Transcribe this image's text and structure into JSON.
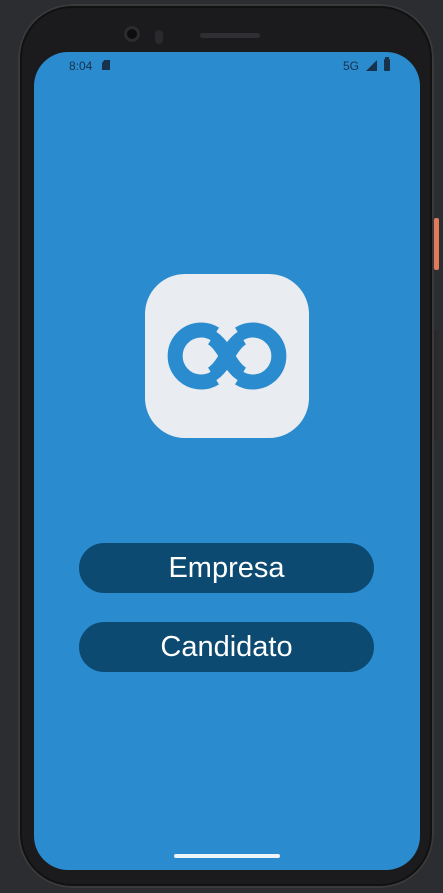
{
  "status_bar": {
    "time": "8:04",
    "network": "5G",
    "icons": [
      "sim-card-icon",
      "signal-icon",
      "battery-icon"
    ]
  },
  "app": {
    "logo_icon": "linked-rings-logo-icon",
    "background_color": "#2a8bcf",
    "button_color": "#0d4a71"
  },
  "buttons": {
    "empresa_label": "Empresa",
    "candidato_label": "Candidato"
  }
}
